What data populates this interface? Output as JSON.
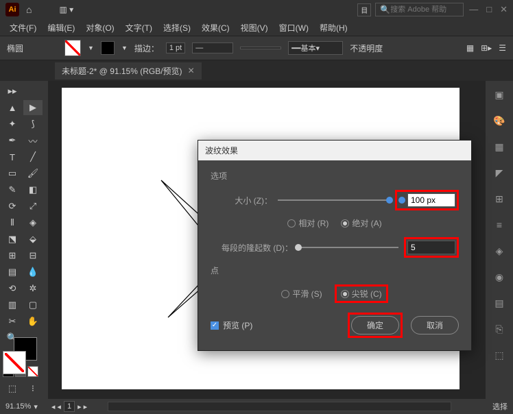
{
  "app": {
    "logo": "Ai"
  },
  "search": {
    "placeholder": "搜索 Adobe 帮助"
  },
  "menu": {
    "file": "文件(F)",
    "edit": "编辑(E)",
    "object": "对象(O)",
    "type": "文字(T)",
    "select": "选择(S)",
    "effect": "效果(C)",
    "view": "视图(V)",
    "window": "窗口(W)",
    "help": "帮助(H)"
  },
  "options": {
    "shape": "椭圆",
    "stroke_label": "描边：",
    "stroke_val": "1 pt",
    "style_label": "基本",
    "opacity_label": "不透明度"
  },
  "doc": {
    "tab_title": "未标题-2* @ 91.15% (RGB/预览)"
  },
  "status": {
    "zoom": "91.15%",
    "nav_val": "1",
    "sel_label": "选择"
  },
  "dialog": {
    "title": "波纹效果",
    "section_options": "选项",
    "size_label": "大小 (Z)：",
    "size_value": "100 px",
    "radio_relative": "相对 (R)",
    "radio_absolute": "绝对 (A)",
    "ridges_label": "每段的隆起数 (D)：",
    "ridges_value": "5",
    "section_points": "点",
    "radio_smooth": "平滑 (S)",
    "radio_corner": "尖锐 (C)",
    "preview_label": "预览 (P)",
    "btn_ok": "确定",
    "btn_cancel": "取消"
  }
}
